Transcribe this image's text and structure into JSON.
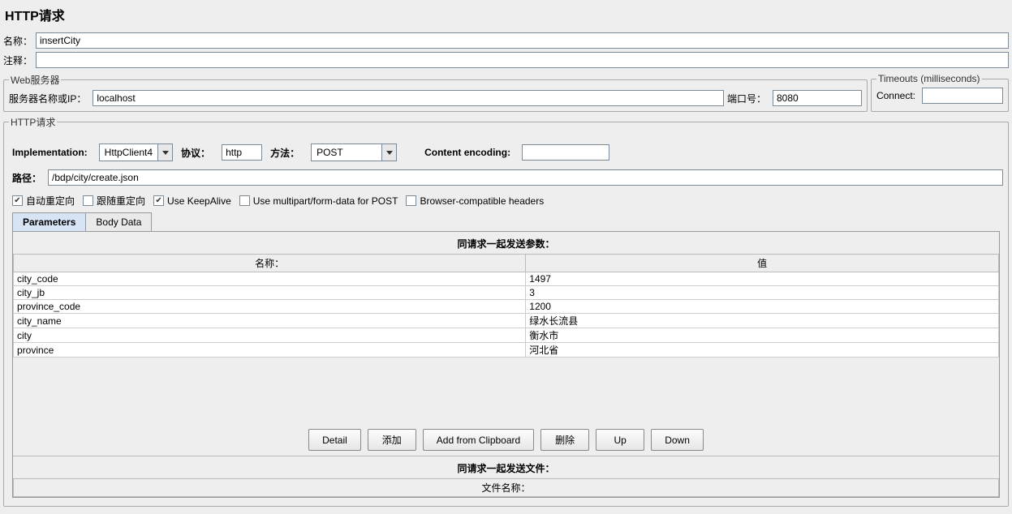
{
  "title": "HTTP请求",
  "basic": {
    "name_label": "名称：",
    "name_value": "insertCity",
    "comment_label": "注释："
  },
  "web_server": {
    "legend": "Web服务器",
    "server_label": "服务器名称或IP：",
    "server_value": "localhost",
    "port_label": "端口号：",
    "port_value": "8080"
  },
  "timeouts": {
    "legend": "Timeouts (milliseconds)",
    "connect_label": "Connect:"
  },
  "http": {
    "legend": "HTTP请求",
    "impl_label": "Implementation:",
    "impl_value": "HttpClient4",
    "protocol_label": "协议：",
    "protocol_value": "http",
    "method_label": "方法：",
    "method_value": "POST",
    "encoding_label": "Content encoding:",
    "path_label": "路径：",
    "path_value": "/bdp/city/create.json",
    "checkboxes": {
      "auto_redirect": "自动重定向",
      "follow_redirect": "跟随重定向",
      "keepalive": "Use KeepAlive",
      "multipart": "Use multipart/form-data for POST",
      "browser_compat": "Browser-compatible headers"
    }
  },
  "tabs": {
    "parameters": "Parameters",
    "body_data": "Body Data"
  },
  "params_section": {
    "title": "同请求一起发送参数：",
    "col_name": "名称：",
    "col_value": "值",
    "rows": [
      {
        "name": "city_code",
        "value": "1497"
      },
      {
        "name": "city_jb",
        "value": "3"
      },
      {
        "name": "province_code",
        "value": "1200"
      },
      {
        "name": "city_name",
        "value": "绿水长流县"
      },
      {
        "name": "city",
        "value": "衡水市"
      },
      {
        "name": "province",
        "value": "河北省"
      }
    ]
  },
  "buttons": {
    "detail": "Detail",
    "add": "添加",
    "add_clipboard": "Add from Clipboard",
    "delete": "删除",
    "up": "Up",
    "down": "Down"
  },
  "files_section": {
    "title": "同请求一起发送文件：",
    "col_filename": "文件名称："
  }
}
